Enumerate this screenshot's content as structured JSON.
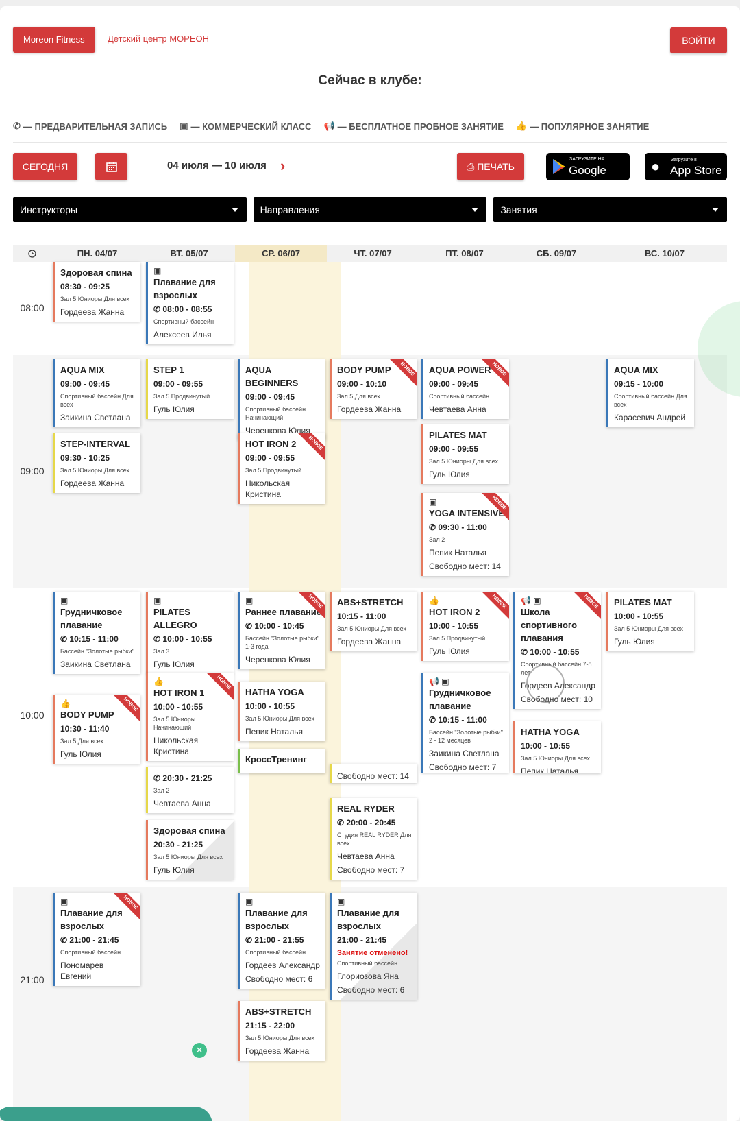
{
  "header": {
    "brand_label": "Moreon Fitness",
    "kids_link": "Детский центр МОРЕОН",
    "login_label": "ВОЙТИ",
    "now_title": "Сейчас в клубе:"
  },
  "legend": [
    {
      "icon": "phone-icon",
      "glyph": "✆",
      "label": "— ПРЕДВАРИТЕЛЬНАЯ ЗАПИСЬ"
    },
    {
      "icon": "money-icon",
      "glyph": "▣",
      "label": "— КОММЕРЧЕСКИЙ КЛАСС"
    },
    {
      "icon": "megaphone-icon",
      "glyph": "📢",
      "label": "— БЕСПЛАТНОЕ ПРОБНОЕ ЗАНЯТИЕ"
    },
    {
      "icon": "thumbs-up-icon",
      "glyph": "👍",
      "label": "— ПОПУЛЯРНОЕ ЗАНЯТИЕ"
    }
  ],
  "toolbar": {
    "today_label": "СЕГОДНЯ",
    "date_from": "04 июля",
    "date_to": "10 июля",
    "print_label": "ПЕЧАТЬ",
    "google_small": "ЗАГРУЗИТЕ НА",
    "google_big": "Google play",
    "apple_small": "Загрузите в",
    "apple_big": "App Store"
  },
  "filters": [
    "Инструкторы",
    "Направления",
    "Занятия"
  ],
  "days": [
    "ПН. 04/07",
    "ВТ. 05/07",
    "СР. 06/07",
    "ЧТ. 07/07",
    "ПТ. 08/07",
    "СБ. 09/07",
    "ВС. 10/07"
  ],
  "times": [
    "08:00",
    "09:00",
    "10:00",
    "21:00"
  ],
  "new_badge": "НОВОЕ",
  "cards": [
    {
      "id": "c1",
      "title": "Здоровая спина",
      "time": "08:30 - 09:25",
      "room": "Зал 5 Юниоры Для всех",
      "instructor": "Гордеева Жанна",
      "color": "#e57a5e"
    },
    {
      "id": "c2",
      "icons": "▣",
      "title": "Плавание для взрослых",
      "time": "✆ 08:00 - 08:55",
      "room": "Спортивный бассейн",
      "instructor": "Алексеев Илья",
      "color": "#3b78b8"
    },
    {
      "id": "c3",
      "title": "AQUA MIX",
      "time": "09:00 - 09:45",
      "room": "Спортивный бассейн Для всех",
      "instructor": "Заикина Светлана",
      "color": "#3b78b8"
    },
    {
      "id": "c4",
      "title": "STEP-INTERVAL",
      "time": "09:30 - 10:25",
      "room": "Зал 5 Юниоры Для всех",
      "instructor": "Гордеева Жанна",
      "color": "#e6d84a"
    },
    {
      "id": "c5",
      "title": "STEP 1",
      "time": "09:00 - 09:55",
      "room": "Зал 5 Продвинутый",
      "instructor": "Гуль Юлия",
      "color": "#e6d84a"
    },
    {
      "id": "c6",
      "title": "AQUA BEGINNERS",
      "time": "09:00 - 09:45",
      "room": "Спортивный бассейн Начинающий",
      "instructor": "Черенкова Юлия",
      "color": "#3b78b8"
    },
    {
      "id": "c7",
      "title": "HOT IRON 2",
      "time": "09:00 - 09:55",
      "room": "Зал 5 Продвинутый",
      "instructor": "Никольская Кристина",
      "color": "#e57a5e"
    },
    {
      "id": "c8",
      "title": "BODY PUMP",
      "time": "09:00 - 10:10",
      "room": "Зал 5 Для всех",
      "instructor": "Гордеева Жанна",
      "color": "#e57a5e"
    },
    {
      "id": "c9",
      "title": "AQUA POWER",
      "time": "09:00 - 09:45",
      "room": "Спортивный бассейн",
      "instructor": "Чевтаева Анна",
      "color": "#3b78b8"
    },
    {
      "id": "c10",
      "title": "PILATES MAT",
      "time": "09:00 - 09:55",
      "room": "Зал 5 Юниоры Для всех",
      "instructor": "Гуль Юлия",
      "color": "#e57a5e"
    },
    {
      "id": "c11",
      "icons": "▣",
      "title": "YOGA INTENSIVE",
      "time": "✆ 09:30 - 11:00",
      "room": "Зал 2",
      "instructor": "Пепик Наталья",
      "free": "Свободно мест: 14",
      "color": "#e57a5e"
    },
    {
      "id": "c12",
      "title": "AQUA MIX",
      "time": "09:15 - 10:00",
      "room": "Спортивный бассейн Для всех",
      "instructor": "Карасевич Андрей",
      "color": "#3b78b8"
    },
    {
      "id": "c13",
      "icons": "▣",
      "title": "Грудничковое плавание",
      "time": "✆ 10:15 - 11:00",
      "room": "Бассейн \"Золотые рыбки\"",
      "instructor": "Заикина Светлана",
      "color": "#3b78b8"
    },
    {
      "id": "c14",
      "icons": "👍",
      "title": "BODY PUMP",
      "time": "10:30 - 11:40",
      "room": "Зал 5 Для всех",
      "instructor": "Гуль Юлия",
      "color": "#e57a5e"
    },
    {
      "id": "c15",
      "icons": "▣",
      "title": "PILATES ALLEGRO",
      "time": "✆ 10:00 - 10:55",
      "room": "Зал 3",
      "instructor": "Гуль Юлия",
      "color": "#e57a5e"
    },
    {
      "id": "c16",
      "icons": "👍",
      "title": "HOT IRON 1",
      "time": "10:00 - 10:55",
      "room": "Зал 5 Юниоры Начинающий",
      "instructor": "Никольская Кристина",
      "color": "#e57a5e"
    },
    {
      "id": "c17",
      "time": "✆ 20:30 - 21:25",
      "room": "Зал 2",
      "instructor": "Чевтаева Анна",
      "color": "#e6d84a"
    },
    {
      "id": "c18",
      "title": "Здоровая спина",
      "time": "20:30 - 21:25",
      "room": "Зал 5 Юниоры Для всех",
      "instructor": "Гуль Юлия",
      "color": "#e57a5e"
    },
    {
      "id": "c19",
      "icons": "▣",
      "title": "Раннее плавание",
      "time": "✆ 10:00 - 10:45",
      "room": "Бассейн \"Золотые рыбки\" 1-3 года",
      "instructor": "Черенкова Юлия",
      "color": "#3b78b8"
    },
    {
      "id": "c20",
      "title": "HATHA YOGA",
      "time": "10:00 - 10:55",
      "room": "Зал 5 Юниоры Для всех",
      "instructor": "Пепик Наталья",
      "color": "#e57a5e"
    },
    {
      "id": "c21",
      "title": "КроссТренинг",
      "color": "#7bbf4c"
    },
    {
      "id": "c22",
      "title": "ABS+STRETCH",
      "time": "10:15 - 11:00",
      "room": "Зал 5 Юниоры Для всех",
      "instructor": "Гордеева Жанна",
      "color": "#e57a5e"
    },
    {
      "id": "c23",
      "free": "Свободно мест: 14",
      "color": "#e6d84a"
    },
    {
      "id": "c24",
      "title": "REAL RYDER",
      "time": "✆ 20:00 - 20:45",
      "room": "Студия REAL RYDER Для всех",
      "instructor": "Чевтаева Анна",
      "free": "Свободно мест: 7",
      "color": "#e6d84a"
    },
    {
      "id": "c25",
      "icons": "👍",
      "title": "HOT IRON 2",
      "time": "10:00 - 10:55",
      "room": "Зал 5 Продвинутый",
      "instructor": "Гуль Юлия",
      "color": "#e57a5e"
    },
    {
      "id": "c26",
      "icons": "📢 ▣",
      "title": "Грудничковое плавание",
      "time": "✆ 10:15 - 11:00",
      "room": "Бассейн \"Золотые рыбки\" 2 - 12 месяцев",
      "instructor": "Заикина Светлана",
      "free": "Свободно мест: 7",
      "color": "#3b78b8"
    },
    {
      "id": "c27",
      "icons": "📢 ▣",
      "title": "Школа спортивного плавания",
      "time": "✆ 10:00 - 10:55",
      "room": "Спортивный бассейн 7-8 лет",
      "instructor": "Гордеев Александр",
      "free": "Свободно мест: 10",
      "color": "#3b78b8"
    },
    {
      "id": "c28",
      "title": "HATHA YOGA",
      "time": "10:00 - 10:55",
      "room": "Зал 5 Юниоры Для всех",
      "instructor": "Пепик Наталья",
      "color": "#e57a5e"
    },
    {
      "id": "c29",
      "title": "PILATES MAT",
      "time": "10:00 - 10:55",
      "room": "Зал 5 Юниоры Для всех",
      "instructor": "Гуль Юлия",
      "color": "#e57a5e"
    },
    {
      "id": "c30",
      "icons": "▣",
      "title": "Плавание для взрослых",
      "time": "✆ 21:00 - 21:45",
      "room": "Спортивный бассейн",
      "instructor": "Пономарев Евгений",
      "color": "#3b78b8"
    },
    {
      "id": "c31",
      "icons": "▣",
      "title": "Плавание для взрослых",
      "time": "✆ 21:00 - 21:55",
      "room": "Спортивный бассейн",
      "instructor": "Гордеев Александр",
      "free": "Свободно мест: 6",
      "color": "#3b78b8"
    },
    {
      "id": "c32",
      "title": "ABS+STRETCH",
      "time": "21:15 - 22:00",
      "room": "Зал 5 Юниоры Для всех",
      "instructor": "Гордеева Жанна",
      "color": "#e57a5e"
    },
    {
      "id": "c33",
      "icons": "▣",
      "title": "Плавание для взрослых",
      "time": "21:00 - 21:45",
      "cancel": "Занятие отменено!",
      "room": "Спортивный бассейн",
      "instructor": "Глориозова Яна",
      "free": "Свободно мест: 6",
      "color": "#3b78b8"
    }
  ]
}
